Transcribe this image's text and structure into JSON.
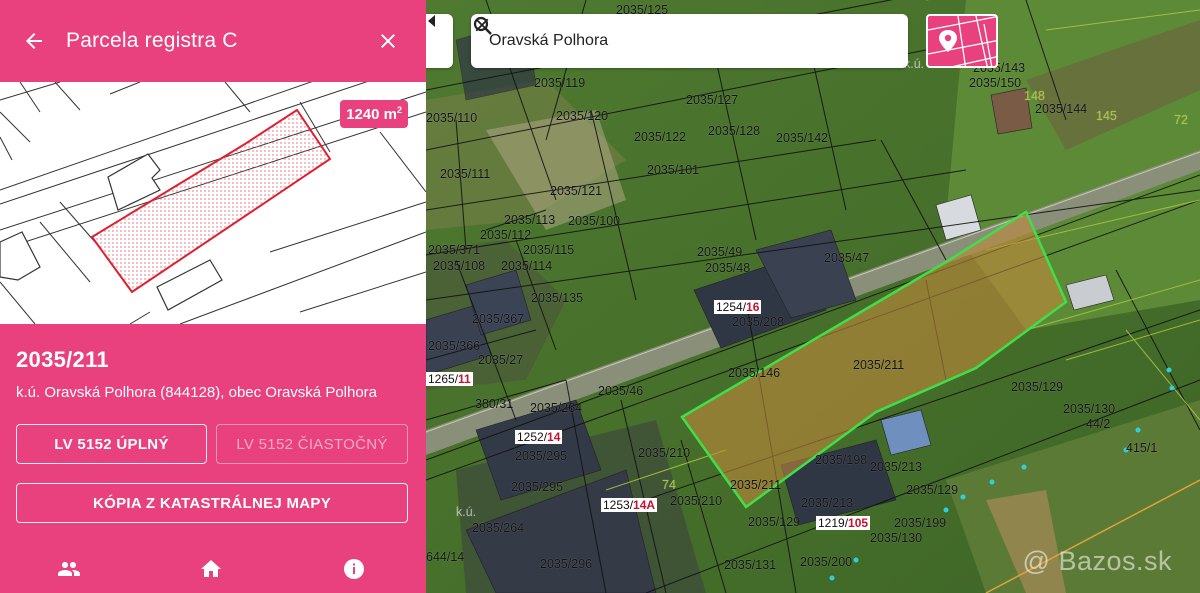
{
  "panel": {
    "title": "Parcela registra C",
    "area_value": "1240 m",
    "area_unit_sup": "2",
    "parcel_number": "2035/211",
    "location": "k.ú. Oravská Polhora (844128), obec Oravská Polhora",
    "lv_full_label": "LV 5152 ÚPLNÝ",
    "lv_partial_label": "LV 5152 ČIASTOČNÝ",
    "copy_label": "KÓPIA Z KATASTRÁLNEJ MAPY",
    "nav_icons": [
      "people-icon",
      "home-icon",
      "info-icon"
    ]
  },
  "search": {
    "value": "Oravská Polhora"
  },
  "colors": {
    "accent": "#e8417e",
    "highlight_parcel": "#3ee04a",
    "parcel_red": "#c4122f"
  },
  "map": {
    "parcel_labels": [
      "2035/125",
      "2035/119",
      "2035/127",
      "2035/120",
      "2035/110",
      "2035/122",
      "2035/128",
      "2035/142",
      "2035/101",
      "2035/111",
      "2035/121",
      "2035/113",
      "2035/100",
      "2035/112",
      "2035/115",
      "2035/371",
      "2035/108",
      "2035/114",
      "2035/49",
      "2035/48",
      "2035/47",
      "2035/135",
      "2035/367",
      "2035/208",
      "2035/366",
      "2035/27",
      "2035/146",
      "2035/211",
      "2035/46",
      "380/31",
      "2035/264",
      "2035/129",
      "2035/130",
      "44/2",
      "415/1",
      "2035/295",
      "2035/210",
      "2035/198",
      "2035/213",
      "2035/211",
      "2035/295",
      "2035/210",
      "2035/213",
      "2035/129",
      "2035/264",
      "2035/129",
      "2035/199",
      "2035/130",
      "2035/296",
      "2035/131",
      "2035/200",
      "644/14",
      "2035/143",
      "2035/150",
      "2035/144"
    ],
    "green_labels": [
      "148",
      "145",
      "72",
      "74"
    ],
    "building_labels": [
      {
        "num": "1254/",
        "sub": "16"
      },
      {
        "num": "1265/",
        "sub": "11"
      },
      {
        "num": "1252/",
        "sub": "14"
      },
      {
        "num": "1253/",
        "sub": "14A"
      },
      {
        "num": "1219/",
        "sub": "105"
      }
    ],
    "light_labels": [
      "k.ú.",
      "k.ú."
    ],
    "watermark": "@ Bazos.sk"
  }
}
